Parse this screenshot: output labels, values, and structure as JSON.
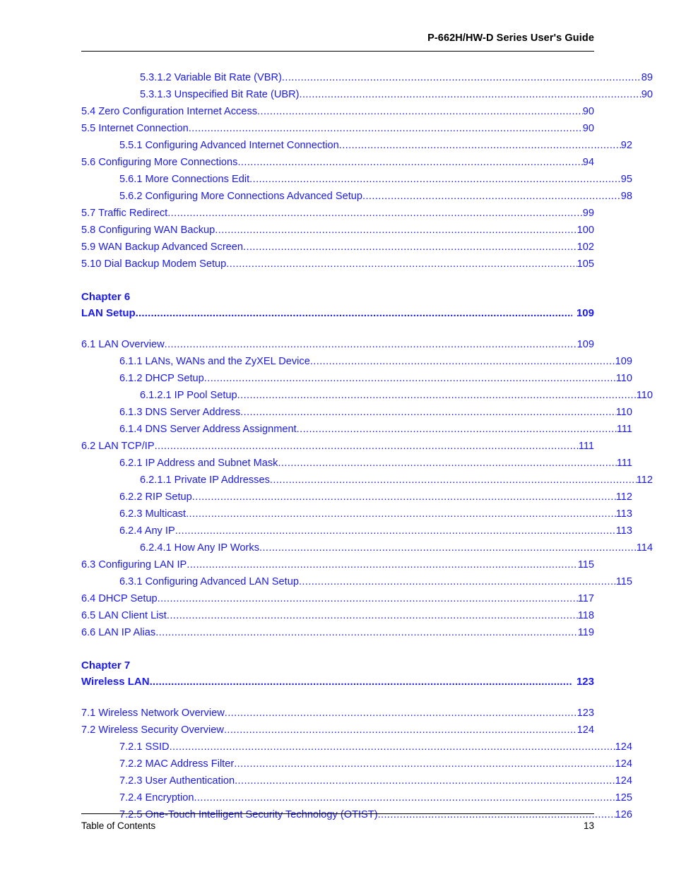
{
  "header": {
    "title": "P-662H/HW-D Series User's Guide"
  },
  "footer": {
    "left": "Table of Contents",
    "page_number": "13"
  },
  "leader": "................................................................................................................................................................",
  "colors": {
    "link_blue": "#1a1aee",
    "text_black": "#000000"
  },
  "toc": {
    "blocks": [
      {
        "type": "entries",
        "entries": [
          {
            "label": "5.3.1.2 Variable Bit Rate (VBR)",
            "page": "89",
            "level": 3
          },
          {
            "label": "5.3.1.3 Unspecified Bit Rate (UBR)",
            "page": "90",
            "level": 3
          },
          {
            "label": "5.4 Zero Configuration Internet Access",
            "page": "90",
            "level": 1
          },
          {
            "label": "5.5 Internet Connection",
            "page": "90",
            "level": 1
          },
          {
            "label": "5.5.1 Configuring Advanced Internet Connection",
            "page": "92",
            "level": 2
          },
          {
            "label": "5.6 Configuring More Connections",
            "page": "94",
            "level": 1
          },
          {
            "label": "5.6.1 More Connections Edit",
            "page": "95",
            "level": 2
          },
          {
            "label": "5.6.2 Configuring More Connections Advanced Setup",
            "page": "98",
            "level": 2
          },
          {
            "label": "5.7 Traffic Redirect",
            "page": "99",
            "level": 1
          },
          {
            "label": "5.8 Configuring WAN Backup",
            "page": "100",
            "level": 1
          },
          {
            "label": "5.9 WAN Backup Advanced Screen",
            "page": "102",
            "level": 1
          },
          {
            "label": "5.10 Dial Backup Modem Setup",
            "page": "105",
            "level": 1
          }
        ]
      },
      {
        "type": "chapter",
        "chapter_label": "Chapter 6",
        "title": "LAN Setup",
        "page": "109"
      },
      {
        "type": "entries",
        "entries": [
          {
            "label": "6.1 LAN Overview",
            "page": "109",
            "level": 1
          },
          {
            "label": "6.1.1 LANs, WANs and the ZyXEL Device",
            "page": "109",
            "level": 2
          },
          {
            "label": "6.1.2 DHCP Setup",
            "page": "110",
            "level": 2
          },
          {
            "label": "6.1.2.1 IP Pool Setup",
            "page": "110",
            "level": 3
          },
          {
            "label": "6.1.3 DNS Server Address",
            "page": "110",
            "level": 2
          },
          {
            "label": "6.1.4 DNS Server Address Assignment",
            "page": "111",
            "level": 2
          },
          {
            "label": "6.2 LAN TCP/IP",
            "page": "111",
            "level": 1
          },
          {
            "label": "6.2.1 IP Address and Subnet Mask",
            "page": "111",
            "level": 2
          },
          {
            "label": "6.2.1.1 Private IP Addresses",
            "page": "112",
            "level": 3
          },
          {
            "label": "6.2.2 RIP Setup",
            "page": "112",
            "level": 2
          },
          {
            "label": "6.2.3 Multicast",
            "page": "113",
            "level": 2
          },
          {
            "label": "6.2.4 Any IP",
            "page": "113",
            "level": 2
          },
          {
            "label": "6.2.4.1 How Any IP Works",
            "page": "114",
            "level": 3
          },
          {
            "label": "6.3 Configuring LAN IP",
            "page": "115",
            "level": 1
          },
          {
            "label": "6.3.1 Configuring Advanced LAN Setup",
            "page": "115",
            "level": 2
          },
          {
            "label": "6.4 DHCP Setup",
            "page": "117",
            "level": 1
          },
          {
            "label": "6.5 LAN Client List",
            "page": "118",
            "level": 1
          },
          {
            "label": "6.6 LAN IP Alias",
            "page": "119",
            "level": 1
          }
        ]
      },
      {
        "type": "chapter",
        "chapter_label": "Chapter 7",
        "title": "Wireless LAN",
        "page": "123"
      },
      {
        "type": "entries",
        "entries": [
          {
            "label": "7.1 Wireless Network Overview",
            "page": "123",
            "level": 1
          },
          {
            "label": "7.2 Wireless Security Overview",
            "page": "124",
            "level": 1
          },
          {
            "label": "7.2.1 SSID",
            "page": "124",
            "level": 2
          },
          {
            "label": "7.2.2 MAC Address Filter",
            "page": "124",
            "level": 2
          },
          {
            "label": "7.2.3 User Authentication",
            "page": "124",
            "level": 2
          },
          {
            "label": "7.2.4 Encryption",
            "page": "125",
            "level": 2
          },
          {
            "label": "7.2.5 One-Touch Intelligent Security Technology (OTIST)",
            "page": "126",
            "level": 2
          }
        ]
      }
    ]
  }
}
